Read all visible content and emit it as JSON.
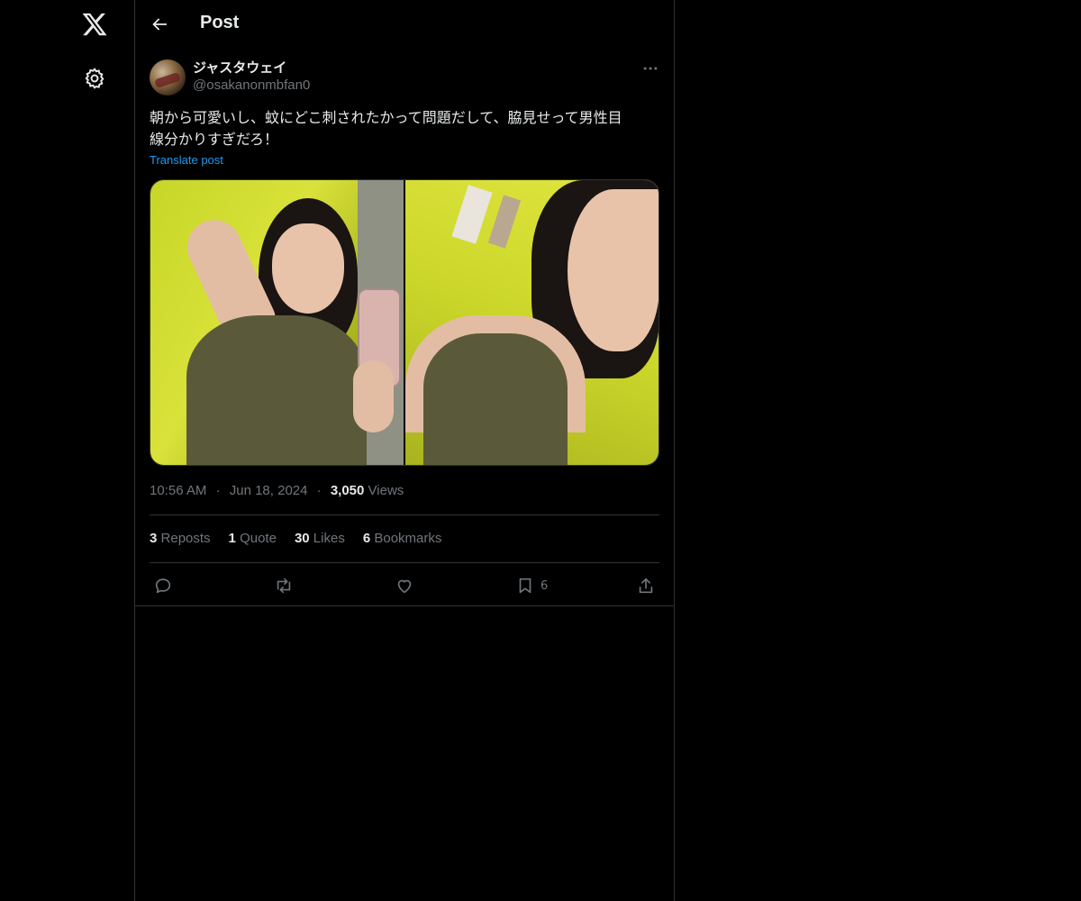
{
  "header": {
    "title": "Post"
  },
  "rail": {
    "logo_icon": "x-logo-icon",
    "settings_icon": "settings-icon"
  },
  "post": {
    "author_name": "ジャスタウェイ",
    "author_handle": "@osakanonmbfan0",
    "text": "朝から可愛いし、蚊にどこ刺されたかって問題だして、脇見せって男性目\n線分かりすぎだろ！",
    "translate_label": "Translate post",
    "time": "10:56 AM",
    "date": "Jun 18, 2024",
    "views_count": "3,050",
    "views_label": "Views",
    "separator": "·"
  },
  "stats": {
    "reposts": {
      "count": "3",
      "label": "Reposts"
    },
    "quotes": {
      "count": "1",
      "label": "Quote"
    },
    "likes": {
      "count": "30",
      "label": "Likes"
    },
    "bookmarks": {
      "count": "6",
      "label": "Bookmarks"
    }
  },
  "actions": {
    "bookmark_count": "6"
  },
  "colors": {
    "background": "#000000",
    "text": "#e7e9ea",
    "muted": "#71767b",
    "accent": "#1d9bf0",
    "border": "#2f3336"
  }
}
